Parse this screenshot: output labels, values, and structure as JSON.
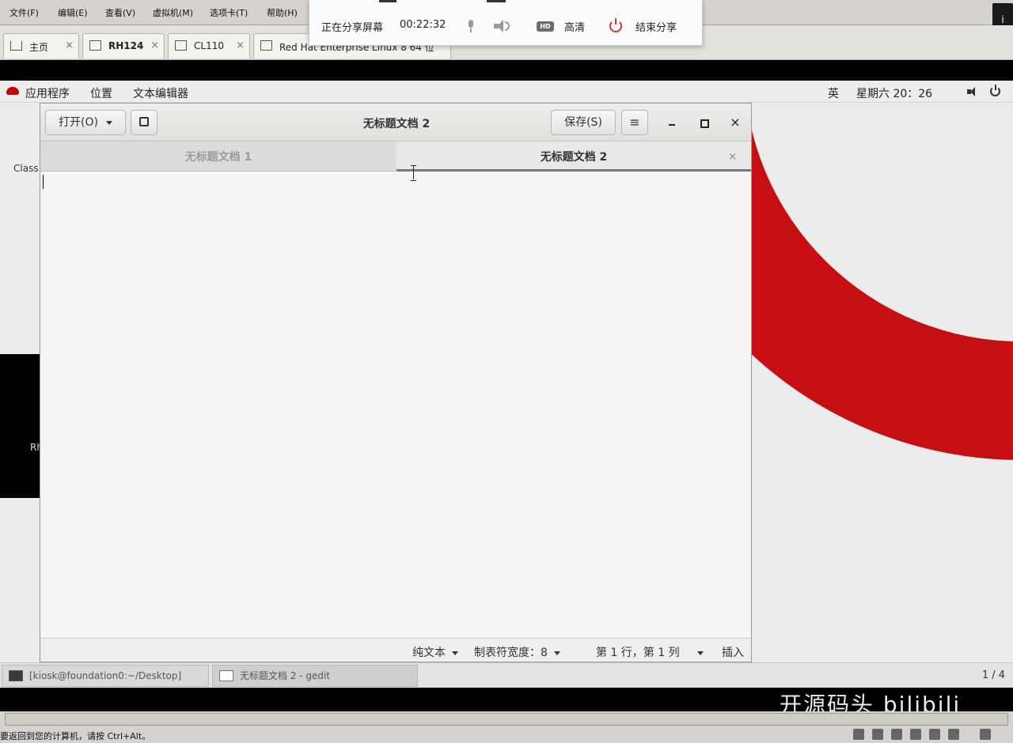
{
  "host": {
    "menu": [
      "文件(F)",
      "编辑(E)",
      "查看(V)",
      "虚拟机(M)",
      "选项卡(T)",
      "帮助(H)"
    ],
    "close_glyph": "i",
    "tabs": [
      {
        "label": "主页",
        "close": "×"
      },
      {
        "label": "RH124",
        "close": "×"
      },
      {
        "label": "CL110",
        "close": "×"
      },
      {
        "label": "Red Hat Enterprise Linux 8 64 位",
        "close": "×"
      }
    ],
    "status_text": "要返回到您的计算机，请按 Ctrl+Alt。"
  },
  "share_bar": {
    "status": "正在分享屏幕",
    "timer": "00:22:32",
    "hd_badge": "HD",
    "hd_label": "高清",
    "end_label": "结束分享"
  },
  "gnome_top": {
    "applications": "应用程序",
    "places": "位置",
    "app_name": "文本编辑器",
    "input_method": "英",
    "clock": "星期六 20：26"
  },
  "desktop": {
    "labels": [
      "Class",
      "Rh"
    ]
  },
  "gedit": {
    "open_label": "打开(O)",
    "save_label": "保存(S)",
    "menu_glyph": "≡",
    "close_glyph": "×",
    "title": "无标题文档 2",
    "tabs": [
      {
        "label": "无标题文档 1"
      },
      {
        "label": "无标题文档 2",
        "close": "×"
      }
    ],
    "status": {
      "language": "纯文本",
      "tab_width": "制表符宽度：8",
      "position": "第 1 行，第 1 列",
      "mode": "插入"
    }
  },
  "window_list": {
    "items": [
      "[kiosk@foundation0:~/Desktop]",
      "无标题文档 2 - gedit"
    ],
    "workspace": "1 / 4"
  },
  "watermark": "开源码头 bilibili",
  "colors": {
    "accent_red": "#c60f13",
    "panel_grey": "#ededed",
    "editor_bg": "#f6f5f4"
  }
}
